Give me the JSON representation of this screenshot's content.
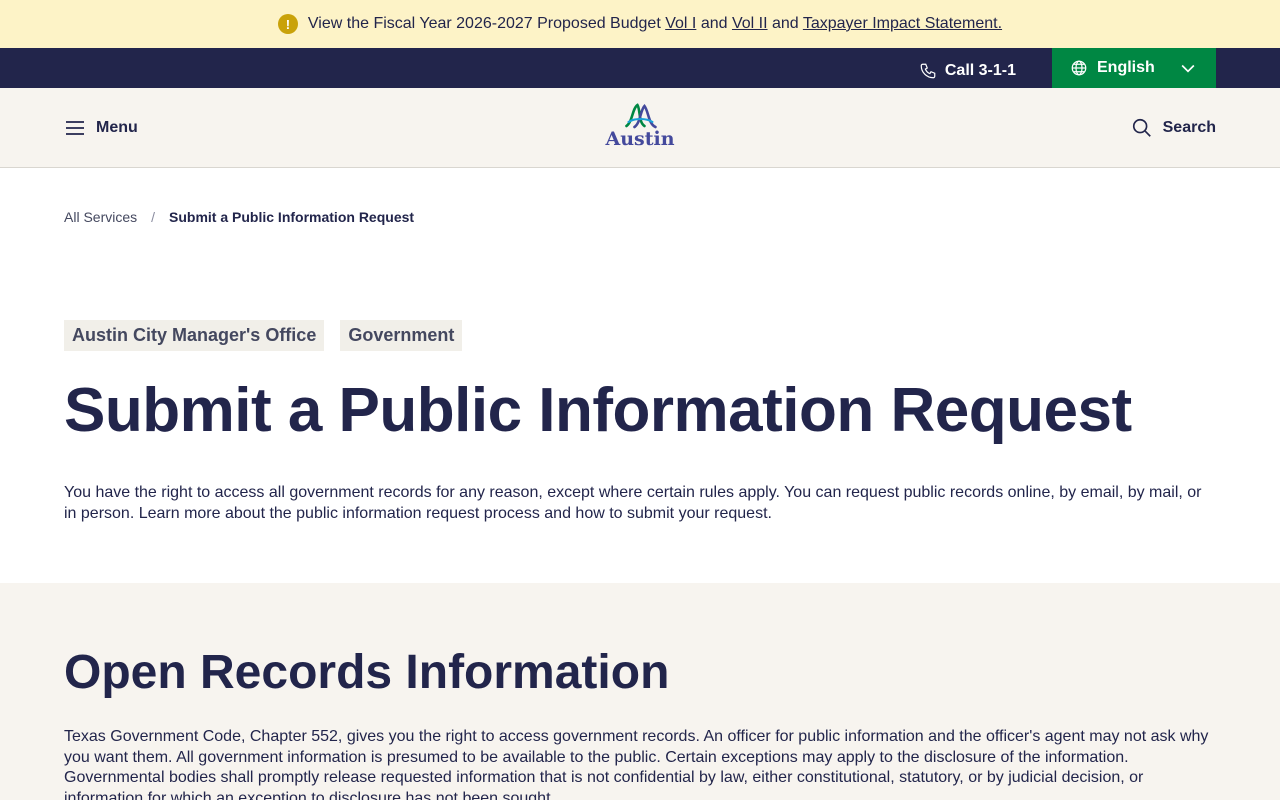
{
  "alert": {
    "text_before": "View the Fiscal Year 2026-2027 Proposed Budget",
    "link_vol1": "Vol I",
    "and1": "and",
    "link_vol2": "Vol II",
    "and2": "and",
    "link_impact": "Taxpayer Impact Statement.",
    "icon": "exclamation-icon",
    "icon_glyph": "!"
  },
  "utility": {
    "call_label": "Call 3-1-1",
    "language": "English"
  },
  "header": {
    "menu_label": "Menu",
    "logo_text": "Austin",
    "search_label": "Search"
  },
  "breadcrumb": {
    "items": [
      "All Services"
    ],
    "separator": "/",
    "current": "Submit a Public Information Request"
  },
  "hero": {
    "tags": [
      "Austin City Manager's Office",
      "Government"
    ],
    "title": "Submit a Public Information Request",
    "intro": "You have the right to access all government records for any reason, except where certain rules apply. You can request public records online, by email, by mail, or in person. Learn more about the public information request process and how to submit your request."
  },
  "info": {
    "heading": "Open Records Information",
    "body": "Texas Government Code, Chapter 552, gives you the right to access government records. An officer for public information and the officer's agent may not ask why you want them. All government information is presumed to be available to the public. Certain exceptions may apply to the disclosure of the information. Governmental bodies shall promptly release requested information that is not confidential by law, either constitutional, statutory, or by judicial decision, or information for which an exception to disclosure has not been sought."
  },
  "colors": {
    "navy": "#22254b",
    "green": "#008743",
    "banner": "#fdf3c7",
    "cream": "#f7f4ef",
    "logo_purple": "#44499c"
  }
}
